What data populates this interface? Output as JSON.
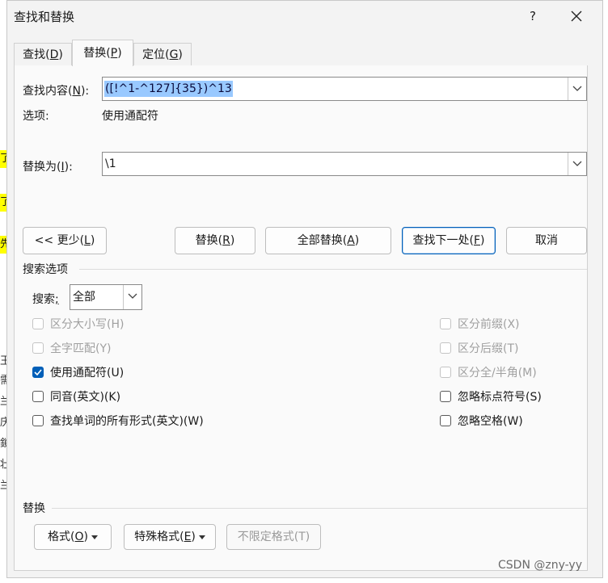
{
  "title": "查找和替换",
  "help": "?",
  "tabs": [
    {
      "label": "查找(",
      "key": "D",
      "end": ")"
    },
    {
      "label": "替换(",
      "key": "P",
      "end": ")"
    },
    {
      "label": "定位(",
      "key": "G",
      "end": ")"
    }
  ],
  "find": {
    "label_pre": "查找内容(",
    "key": "N",
    "label_post": "):",
    "value": "([!^1-^127]{35})^13"
  },
  "options": {
    "label": "选项:",
    "value": "使用通配符"
  },
  "replace": {
    "label_pre": "替换为(",
    "key": "I",
    "label_post": "):",
    "value": "\\1"
  },
  "buttons": {
    "less": {
      "pre": "<< 更少(",
      "key": "L",
      "post": ")"
    },
    "replace": {
      "pre": "替换(",
      "key": "R",
      "post": ")"
    },
    "replace_all": {
      "pre": "全部替换(",
      "key": "A",
      "post": ")"
    },
    "find_next": {
      "pre": "查找下一处(",
      "key": "F",
      "post": ")"
    },
    "cancel": "取消"
  },
  "search_options": {
    "heading": "搜索选项",
    "search_label_pre": "搜索",
    "search_label_key": ";",
    "search_value": "全部",
    "left": [
      {
        "text": "区分大小写(H)",
        "checked": false,
        "disabled": true
      },
      {
        "text": "全字匹配(Y)",
        "checked": false,
        "disabled": true
      },
      {
        "text": "使用通配符(U)",
        "checked": true,
        "disabled": false
      },
      {
        "text": "同音(英文)(K)",
        "checked": false,
        "disabled": false
      },
      {
        "text": "查找单词的所有形式(英文)(W)",
        "checked": false,
        "disabled": false
      }
    ],
    "right": [
      {
        "text": "区分前缀(X)",
        "checked": false,
        "disabled": true
      },
      {
        "text": "区分后缀(T)",
        "checked": false,
        "disabled": true
      },
      {
        "text": "区分全/半角(M)",
        "checked": false,
        "disabled": true
      },
      {
        "text": "忽略标点符号(S)",
        "checked": false,
        "disabled": false
      },
      {
        "text": "忽略空格(W)",
        "checked": false,
        "disabled": false
      }
    ]
  },
  "replace_section": {
    "heading": "替换",
    "format": {
      "pre": "格式(",
      "key": "O",
      "post": ")"
    },
    "special": {
      "pre": "特殊格式(",
      "key": "E",
      "post": ")"
    },
    "no_format": "不限定格式(T)"
  },
  "background": {
    "chars": [
      "了",
      "了",
      "先",
      "王",
      "需",
      "兰",
      "庆",
      "鎖",
      "壮",
      "兰"
    ]
  },
  "watermark": "CSDN @zny-yy"
}
